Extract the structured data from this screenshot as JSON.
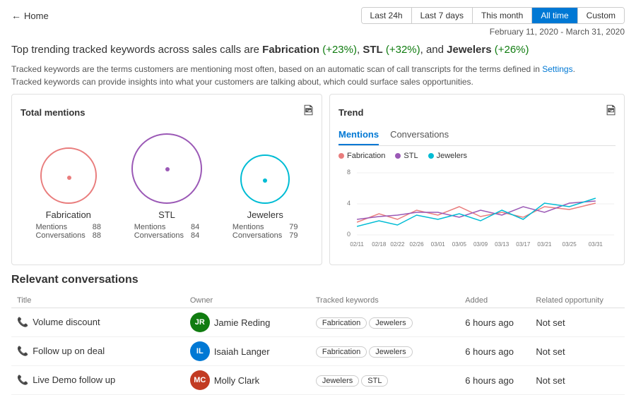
{
  "header": {
    "back_label": "Home",
    "time_filters": [
      "Last 24h",
      "Last 7 days",
      "This month",
      "All time",
      "Custom"
    ],
    "active_filter": "All time",
    "date_range": "February 11, 2020 - March 31, 2020"
  },
  "headline": {
    "prefix": "Top trending tracked keywords across sales calls are ",
    "k1_name": "Fabrication",
    "k1_change": "(+23%)",
    "k2_name": "STL",
    "k2_change": "(+32%)",
    "k3_name": "Jewelers",
    "k3_change": "(+26%)"
  },
  "subtitle": {
    "line1": "Tracked keywords are the terms customers are mentioning most often, based on an automatic scan of call transcripts for the terms defined in Settings.",
    "line2": "Tracked keywords can provide insights into what your customers are talking about, which could surface sales opportunities."
  },
  "mentions_panel": {
    "title": "Total mentions",
    "keywords": [
      {
        "name": "Fabrication",
        "mentions_label": "Mentions",
        "mentions_val": "88",
        "conversations_label": "Conversations",
        "conversations_val": "88",
        "color": "#e97d7d",
        "size": 80
      },
      {
        "name": "STL",
        "mentions_label": "Mentions",
        "mentions_val": "84",
        "conversations_label": "Conversations",
        "conversations_val": "84",
        "color": "#9b59b6",
        "size": 100
      },
      {
        "name": "Jewelers",
        "mentions_label": "Mentions",
        "mentions_val": "79",
        "conversations_label": "Conversations",
        "conversations_val": "79",
        "color": "#00bcd4",
        "size": 70
      }
    ]
  },
  "trend_panel": {
    "title": "Trend",
    "tabs": [
      "Mentions",
      "Conversations"
    ],
    "active_tab": "Mentions",
    "legend": [
      {
        "name": "Fabrication",
        "color": "#e97d7d"
      },
      {
        "name": "STL",
        "color": "#9b59b6"
      },
      {
        "name": "Jewelers",
        "color": "#00bcd4"
      }
    ],
    "x_labels": [
      "02/11",
      "02/18",
      "02/22",
      "02/26",
      "03/01",
      "03/05",
      "03/09",
      "03/13",
      "03/17",
      "03/21",
      "03/25",
      "03/31"
    ],
    "y_labels": [
      "8",
      "4",
      "0"
    ]
  },
  "conversations": {
    "title": "Relevant conversations",
    "columns": [
      "Title",
      "Owner",
      "Tracked keywords",
      "Added",
      "Related opportunity"
    ],
    "rows": [
      {
        "icon": "phone",
        "title": "Volume discount",
        "owner_initials": "JR",
        "owner_name": "Jamie Reding",
        "owner_color": "#107c10",
        "keywords": [
          "Fabrication",
          "Jewelers"
        ],
        "added": "6 hours ago",
        "opportunity": "Not set"
      },
      {
        "icon": "phone",
        "title": "Follow up on deal",
        "owner_initials": "IL",
        "owner_name": "Isaiah Langer",
        "owner_color": "#0078d4",
        "keywords": [
          "Fabrication",
          "Jewelers"
        ],
        "added": "6 hours ago",
        "opportunity": "Not set"
      },
      {
        "icon": "phone",
        "title": "Live Demo follow up",
        "owner_initials": "MC",
        "owner_name": "Molly Clark",
        "owner_color": "#c23b22",
        "keywords": [
          "Jewelers",
          "STL"
        ],
        "added": "6 hours ago",
        "opportunity": "Not set"
      }
    ]
  },
  "colors": {
    "accent": "#0078d4",
    "positive": "#107c10"
  }
}
